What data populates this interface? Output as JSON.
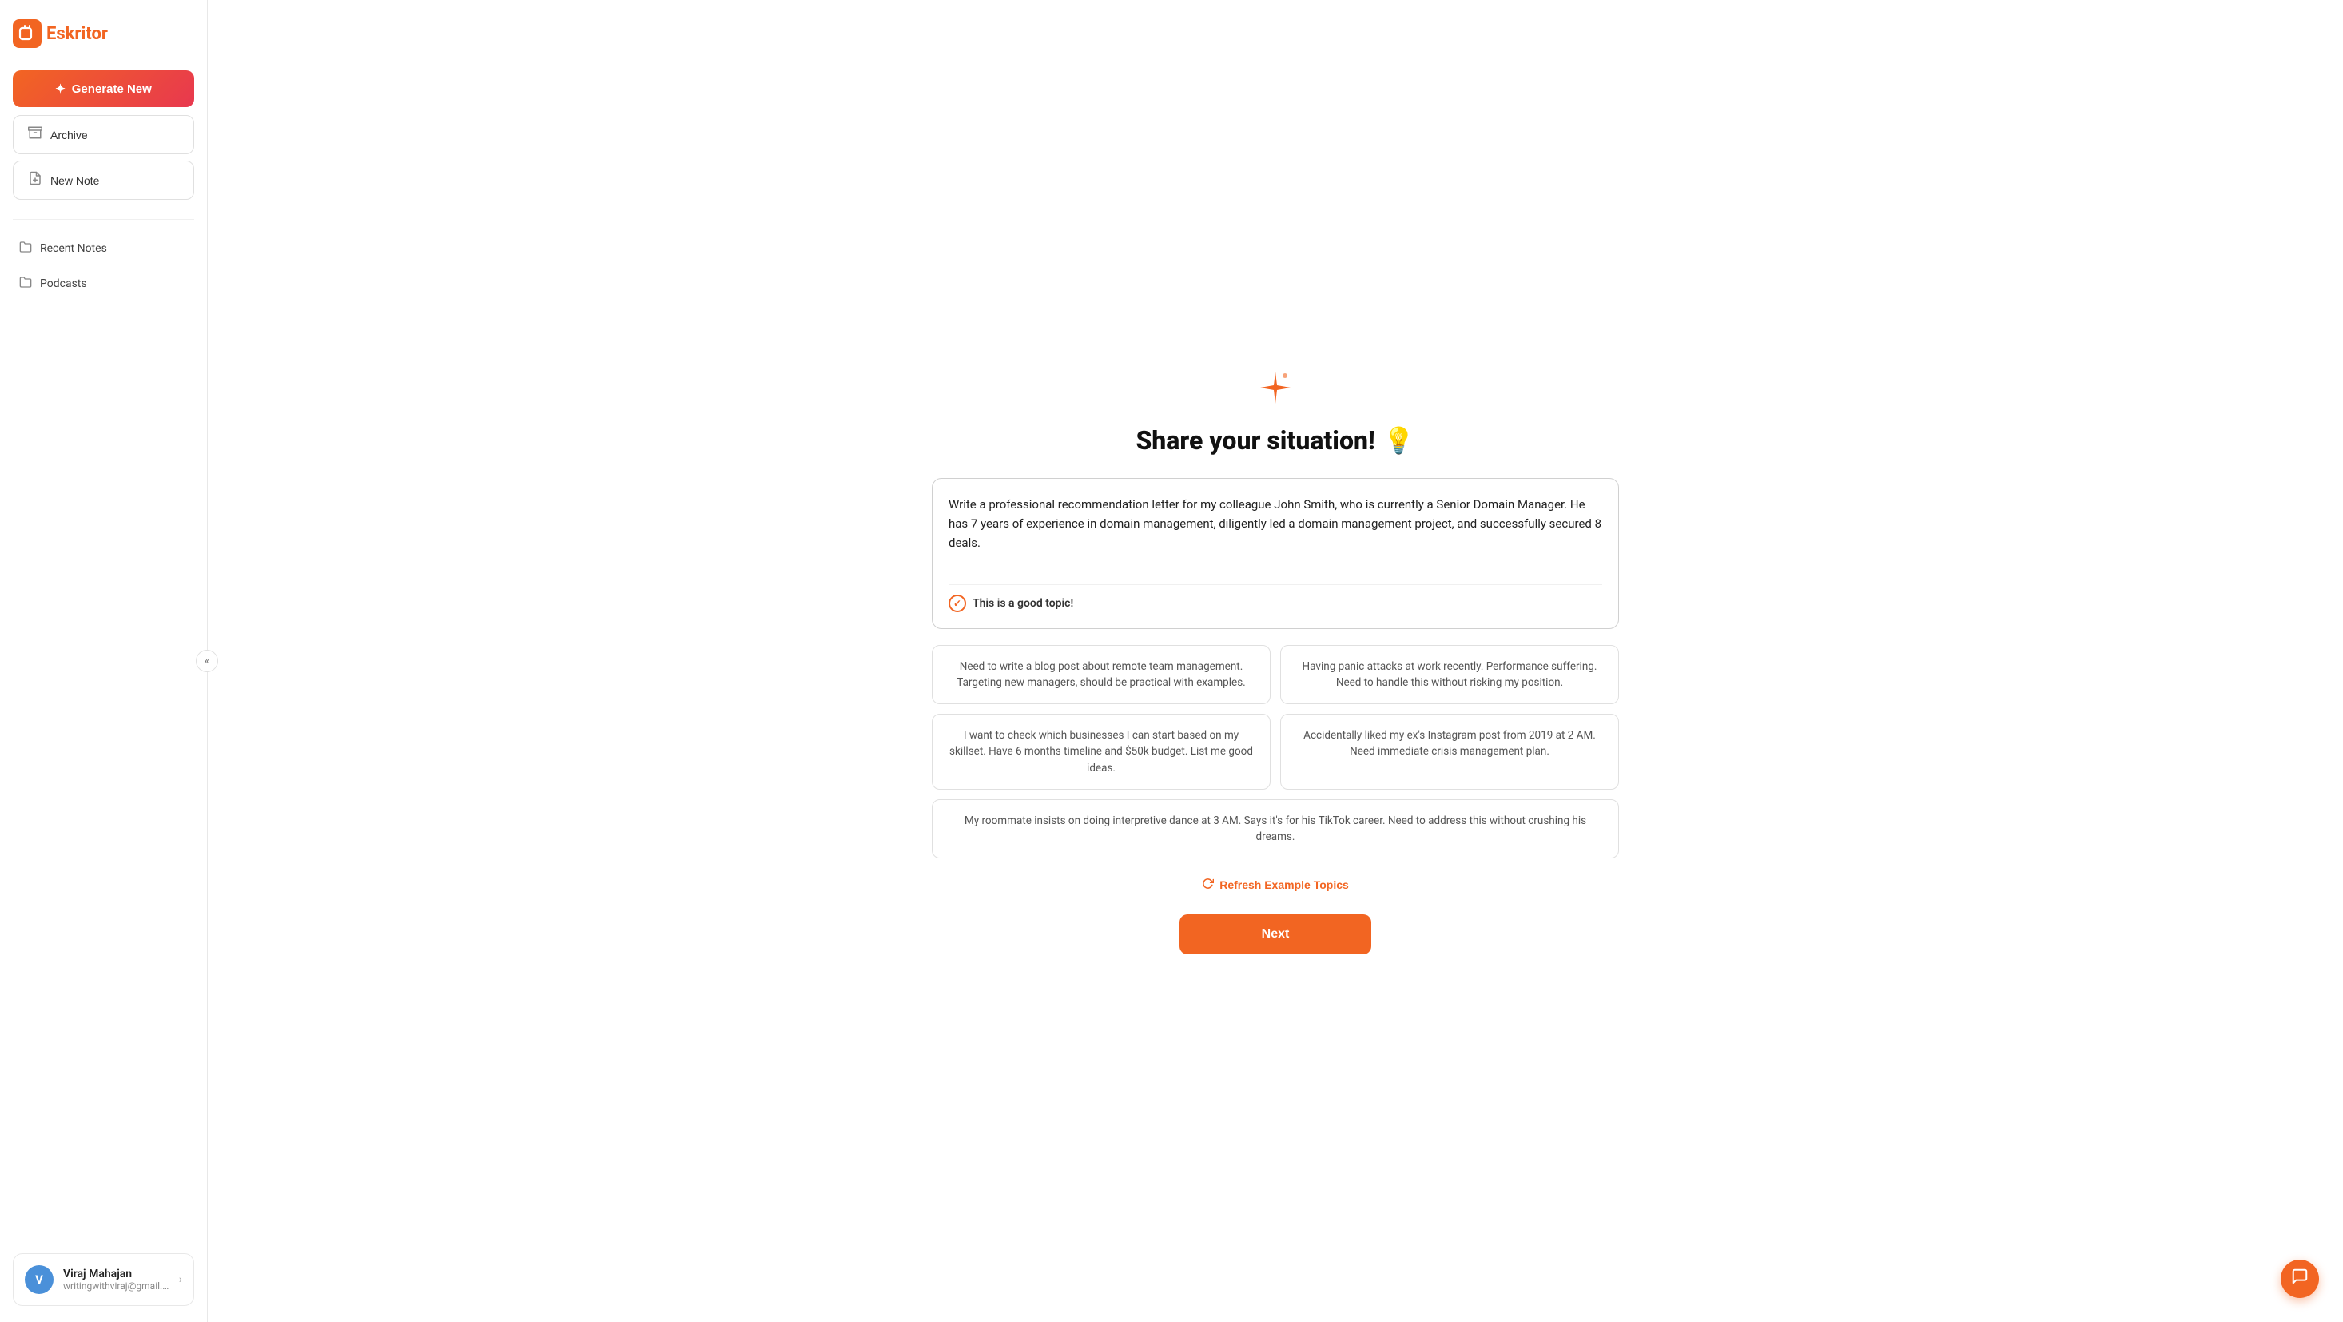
{
  "logo": {
    "icon_letter": "E",
    "text_prefix": "",
    "text_brand": "Eskritor"
  },
  "sidebar": {
    "generate_btn_label": "Generate New",
    "archive_label": "Archive",
    "new_note_label": "New Note",
    "recent_notes_label": "Recent Notes",
    "podcasts_label": "Podcasts",
    "collapse_icon": "«"
  },
  "user": {
    "avatar_letter": "V",
    "name": "Viraj Mahajan",
    "email": "writingwithviraj@gmail.com"
  },
  "main": {
    "sparkle": "✦",
    "title": "Share your situation!",
    "title_emoji": "💡",
    "textarea_value": "Write a professional recommendation letter for my colleague John Smith, who is currently a Senior Domain Manager. He has 7 years of experience in domain management, diligently led a domain management project, and successfully secured 8 deals.",
    "good_topic_text": "This is a good topic!",
    "example_topics": [
      {
        "id": "topic1",
        "text": "Need to write a blog post about remote team management. Targeting new managers, should be practical with examples."
      },
      {
        "id": "topic2",
        "text": "Having panic attacks at work recently. Performance suffering. Need to handle this without risking my position."
      },
      {
        "id": "topic3",
        "text": "I want to check which businesses I can start based on my skillset. Have 6 months timeline and $50k budget. List me good ideas."
      },
      {
        "id": "topic4",
        "text": "Accidentally liked my ex's Instagram post from 2019 at 2 AM. Need immediate crisis management plan."
      },
      {
        "id": "topic5",
        "text": "My roommate insists on doing interpretive dance at 3 AM. Says it's for his TikTok career. Need to address this without crushing his dreams."
      }
    ],
    "refresh_label": "Refresh Example Topics",
    "next_label": "Next"
  }
}
